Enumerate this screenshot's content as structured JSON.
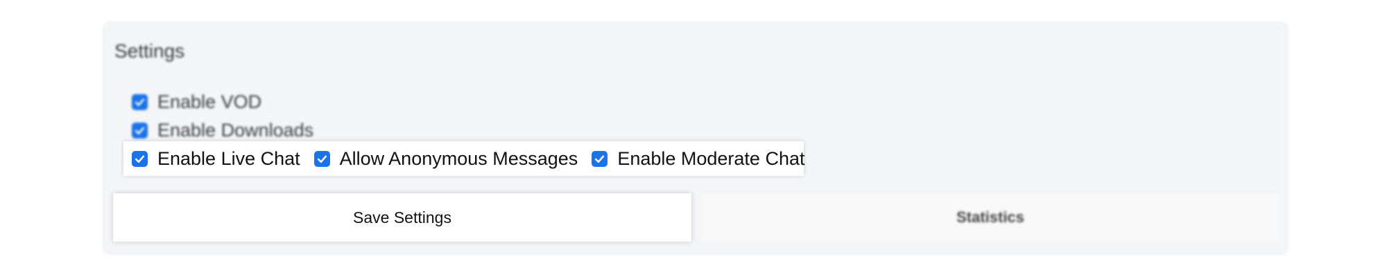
{
  "settings": {
    "title": "Settings",
    "options": {
      "vod": {
        "label": "Enable VOD",
        "checked": true
      },
      "downloads": {
        "label": "Enable Downloads",
        "checked": true
      },
      "live_chat": {
        "label": "Enable Live Chat",
        "checked": true
      },
      "anonymous": {
        "label": "Allow Anonymous Messages",
        "checked": true
      },
      "moderate": {
        "label": "Enable Moderate Chat",
        "checked": true
      }
    },
    "save_label": "Save Settings",
    "stats_label": "Statistics"
  },
  "colors": {
    "accent": "#1a73e8",
    "panel_bg": "#f4f5f7"
  },
  "icons": {
    "checkbox": "checkmark-icon"
  }
}
